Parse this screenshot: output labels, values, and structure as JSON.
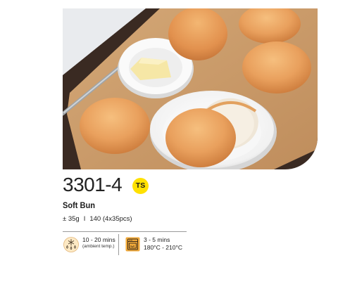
{
  "product": {
    "code": "3301-4",
    "badge": "TS",
    "name": "Soft Bun",
    "weight": "± 35g",
    "separator": "I",
    "pack": "140 (4x35pcs)"
  },
  "prep": {
    "thaw_time": "10 - 20 mins",
    "thaw_note": "(ambient temp.)",
    "thaw_icon": "thaw-drops-icon",
    "bake_time": "3 - 5 mins",
    "bake_temp": "180°C - 210°C",
    "bake_icon": "oven-icon"
  },
  "colors": {
    "badge_yellow": "#ffe100",
    "icon_orange": "#f0a93a",
    "bun": "#e8a05c",
    "parchment": "#c99a6a",
    "board": "#3a2a22"
  }
}
